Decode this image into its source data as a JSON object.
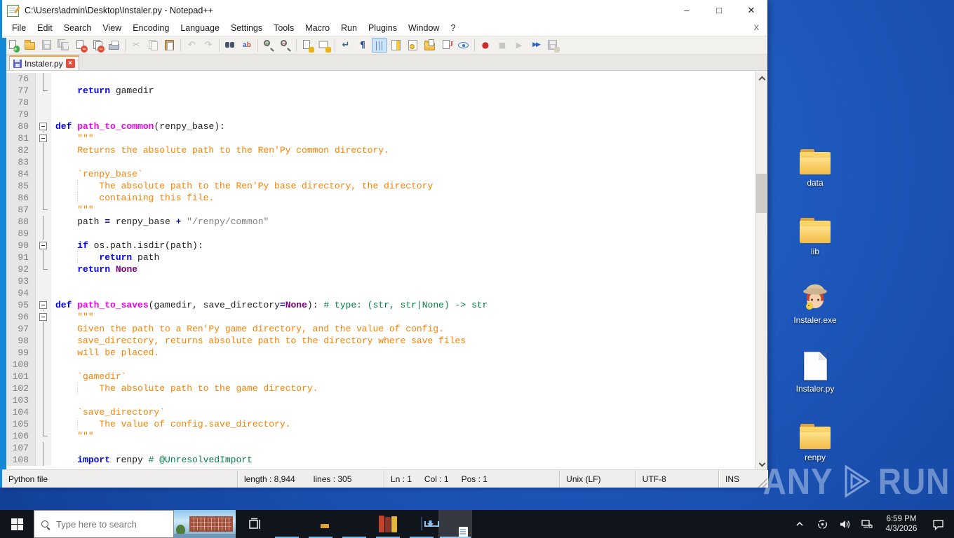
{
  "window": {
    "title": "C:\\Users\\admin\\Desktop\\Instaler.py - Notepad++",
    "controls": {
      "minimize": "–",
      "maximize": "□",
      "close": "✕"
    },
    "menu": [
      "File",
      "Edit",
      "Search",
      "View",
      "Encoding",
      "Language",
      "Settings",
      "Tools",
      "Macro",
      "Run",
      "Plugins",
      "Window",
      "?"
    ],
    "menu_close": "X",
    "tab_label": "Instaler.py"
  },
  "toolbar": {
    "icons": [
      {
        "name": "new-file"
      },
      {
        "name": "open-file"
      },
      {
        "name": "save",
        "dis": 1
      },
      {
        "name": "save-all",
        "dis": 1
      },
      {
        "name": "close-file"
      },
      {
        "name": "close-all-files"
      },
      {
        "name": "print"
      },
      {
        "name": "cut",
        "dis": 1,
        "sep": 1
      },
      {
        "name": "copy",
        "dis": 1
      },
      {
        "name": "paste"
      },
      {
        "name": "undo",
        "dis": 1,
        "sep": 1
      },
      {
        "name": "redo",
        "dis": 1
      },
      {
        "name": "find",
        "sep": 1
      },
      {
        "name": "replace"
      },
      {
        "name": "zoom-in",
        "sep": 1
      },
      {
        "name": "zoom-out"
      },
      {
        "name": "sync-vertical-scroll",
        "sep": 1
      },
      {
        "name": "sync-horizontal-scroll"
      },
      {
        "name": "word-wrap",
        "sep": 1
      },
      {
        "name": "show-all-characters"
      },
      {
        "name": "show-indent-guide",
        "pressed": 1
      },
      {
        "name": "document-map"
      },
      {
        "name": "function-list"
      },
      {
        "name": "folder-as-workspace"
      },
      {
        "name": "document-list"
      },
      {
        "name": "monitoring"
      },
      {
        "name": "start-recording",
        "sep": 1
      },
      {
        "name": "stop-recording",
        "dis": 1
      },
      {
        "name": "playback-macro",
        "dis": 1
      },
      {
        "name": "run-macro-multiple"
      },
      {
        "name": "save-recorded-macro",
        "dis": 1
      }
    ]
  },
  "editor": {
    "lines": [
      {
        "n": 76,
        "f": "m",
        "t": []
      },
      {
        "n": 77,
        "f": "e",
        "t": [
          [
            "p",
            "    "
          ],
          [
            "k",
            "return"
          ],
          [
            "p",
            " gamedir"
          ]
        ]
      },
      {
        "n": 78,
        "f": "",
        "t": []
      },
      {
        "n": 79,
        "f": "",
        "t": []
      },
      {
        "n": 80,
        "f": "b",
        "t": [
          [
            "k",
            "def"
          ],
          [
            "p",
            " "
          ],
          [
            "fn",
            "path_to_common"
          ],
          [
            "p",
            "(renpy_base):"
          ]
        ]
      },
      {
        "n": 81,
        "f": "b",
        "t": [
          [
            "d",
            "    \"\"\""
          ]
        ]
      },
      {
        "n": 82,
        "f": "m",
        "t": [
          [
            "d",
            "    Returns the absolute path to the Ren'Py common directory."
          ]
        ]
      },
      {
        "n": 83,
        "f": "m",
        "t": []
      },
      {
        "n": 84,
        "f": "m",
        "t": [
          [
            "d",
            "    `renpy_base`"
          ]
        ]
      },
      {
        "n": 85,
        "f": "m",
        "g": 1,
        "t": [
          [
            "d",
            "        The absolute path to the Ren'Py base directory, the directory"
          ]
        ]
      },
      {
        "n": 86,
        "f": "m",
        "g": 1,
        "t": [
          [
            "d",
            "        containing this file."
          ]
        ]
      },
      {
        "n": 87,
        "f": "e",
        "t": [
          [
            "d",
            "    \"\"\""
          ]
        ]
      },
      {
        "n": 88,
        "f": "m",
        "t": [
          [
            "p",
            "    path "
          ],
          [
            "o",
            "="
          ],
          [
            "p",
            " renpy_base "
          ],
          [
            "o",
            "+"
          ],
          [
            "p",
            " "
          ],
          [
            "s",
            "\"/renpy/common\""
          ]
        ]
      },
      {
        "n": 89,
        "f": "m",
        "t": []
      },
      {
        "n": 90,
        "f": "b",
        "t": [
          [
            "p",
            "    "
          ],
          [
            "k",
            "if"
          ],
          [
            "p",
            " os.path.isdir(path):"
          ]
        ]
      },
      {
        "n": 91,
        "f": "m",
        "g": 1,
        "t": [
          [
            "p",
            "        "
          ],
          [
            "k",
            "return"
          ],
          [
            "p",
            " path"
          ]
        ]
      },
      {
        "n": 92,
        "f": "e",
        "t": [
          [
            "p",
            "    "
          ],
          [
            "k",
            "return"
          ],
          [
            "p",
            " "
          ],
          [
            "k2",
            "None"
          ]
        ]
      },
      {
        "n": 93,
        "f": "",
        "t": []
      },
      {
        "n": 94,
        "f": "",
        "t": []
      },
      {
        "n": 95,
        "f": "b",
        "t": [
          [
            "k",
            "def"
          ],
          [
            "p",
            " "
          ],
          [
            "fn",
            "path_to_saves"
          ],
          [
            "p",
            "(gamedir, save_directory"
          ],
          [
            "o",
            "="
          ],
          [
            "k2",
            "None"
          ],
          [
            "p",
            "): "
          ],
          [
            "c",
            "# type: (str, str|None) -> str"
          ]
        ]
      },
      {
        "n": 96,
        "f": "b",
        "t": [
          [
            "d",
            "    \"\"\""
          ]
        ]
      },
      {
        "n": 97,
        "f": "m",
        "t": [
          [
            "d",
            "    Given the path to a Ren'Py game directory, and the value of config."
          ]
        ]
      },
      {
        "n": 98,
        "f": "m",
        "t": [
          [
            "d",
            "    save_directory, returns absolute path to the directory where save files"
          ]
        ]
      },
      {
        "n": 99,
        "f": "m",
        "t": [
          [
            "d",
            "    will be placed."
          ]
        ]
      },
      {
        "n": 100,
        "f": "m",
        "t": []
      },
      {
        "n": 101,
        "f": "m",
        "t": [
          [
            "d",
            "    `gamedir`"
          ]
        ]
      },
      {
        "n": 102,
        "f": "m",
        "g": 1,
        "t": [
          [
            "d",
            "        The absolute path to the game directory."
          ]
        ]
      },
      {
        "n": 103,
        "f": "m",
        "t": []
      },
      {
        "n": 104,
        "f": "m",
        "t": [
          [
            "d",
            "    `save_directory`"
          ]
        ]
      },
      {
        "n": 105,
        "f": "m",
        "g": 1,
        "t": [
          [
            "d",
            "        The value of config.save_directory."
          ]
        ]
      },
      {
        "n": 106,
        "f": "e",
        "t": [
          [
            "d",
            "    \"\"\""
          ]
        ]
      },
      {
        "n": 107,
        "f": "m",
        "t": []
      },
      {
        "n": 108,
        "f": "m",
        "t": [
          [
            "p",
            "    "
          ],
          [
            "k",
            "import"
          ],
          [
            "p",
            " renpy "
          ],
          [
            "c",
            "# @UnresolvedImport"
          ]
        ]
      }
    ]
  },
  "status_bar": {
    "doc_type": "Python file",
    "length": "length : 8,944",
    "lines": "lines : 305",
    "ln": "Ln : 1",
    "col": "Col : 1",
    "pos": "Pos : 1",
    "eol": "Unix (LF)",
    "encoding": "UTF-8",
    "typing_mode": "INS"
  },
  "desktop": {
    "icons": [
      {
        "label": "data",
        "type": "folder"
      },
      {
        "label": "lib",
        "type": "folder"
      },
      {
        "label": "Instaler.exe",
        "type": "exe"
      },
      {
        "label": "Instaler.py",
        "type": "file"
      },
      {
        "label": "renpy",
        "type": "folder"
      }
    ]
  },
  "watermark": {
    "brand_left": "ANY",
    "brand_right": "RUN"
  },
  "taskbar": {
    "search_placeholder": "Type here to search",
    "apps": [
      "edge",
      "file-explorer",
      "firefox",
      "winrar",
      "installer",
      "notepad-plus-plus"
    ],
    "active_app": "notepad-plus-plus",
    "clock_time": "6:59 PM",
    "clock_date": "4/3/2026"
  }
}
